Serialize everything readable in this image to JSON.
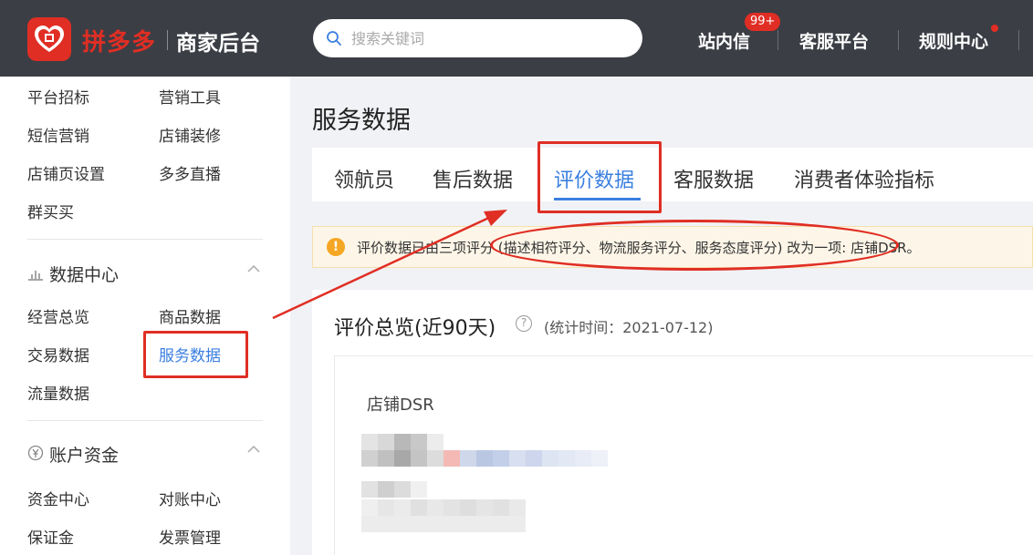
{
  "header": {
    "brand": "拼多多",
    "brand_sub": "商家后台",
    "search_placeholder": "搜索关键词",
    "nav": {
      "messages": "站内信",
      "messages_badge": "99+",
      "customer_service": "客服平台",
      "rules": "规则中心"
    }
  },
  "sidebar": {
    "top_items": [
      "平台招标",
      "营销工具",
      "短信营销",
      "店铺装修",
      "店铺页设置",
      "多多直播",
      "群买买"
    ],
    "data_center": {
      "title": "数据中心",
      "items": [
        "经营总览",
        "商品数据",
        "交易数据",
        "服务数据",
        "流量数据"
      ]
    },
    "account_funds": {
      "title": "账户资金",
      "items": [
        "资金中心",
        "对账中心",
        "保证金",
        "发票管理"
      ]
    }
  },
  "main": {
    "title": "服务数据",
    "tabs": [
      "领航员",
      "售后数据",
      "评价数据",
      "客服数据",
      "消费者体验指标"
    ],
    "active_tab": "评价数据",
    "notice": "评价数据已由三项评分 (描述相符评分、物流服务评分、服务态度评分) 改为一项: 店铺DSR。",
    "overview_title": "评价总览(近90天)",
    "stat_time": "(统计时间：2021-07-12)",
    "dsr_label": "店铺DSR"
  },
  "colors": {
    "brand_red": "#e02e24",
    "topbar": "#3b3e45",
    "accent_blue": "#3a7fe0",
    "notice_bg": "#fdf6e8",
    "warning": "#f5a623"
  }
}
